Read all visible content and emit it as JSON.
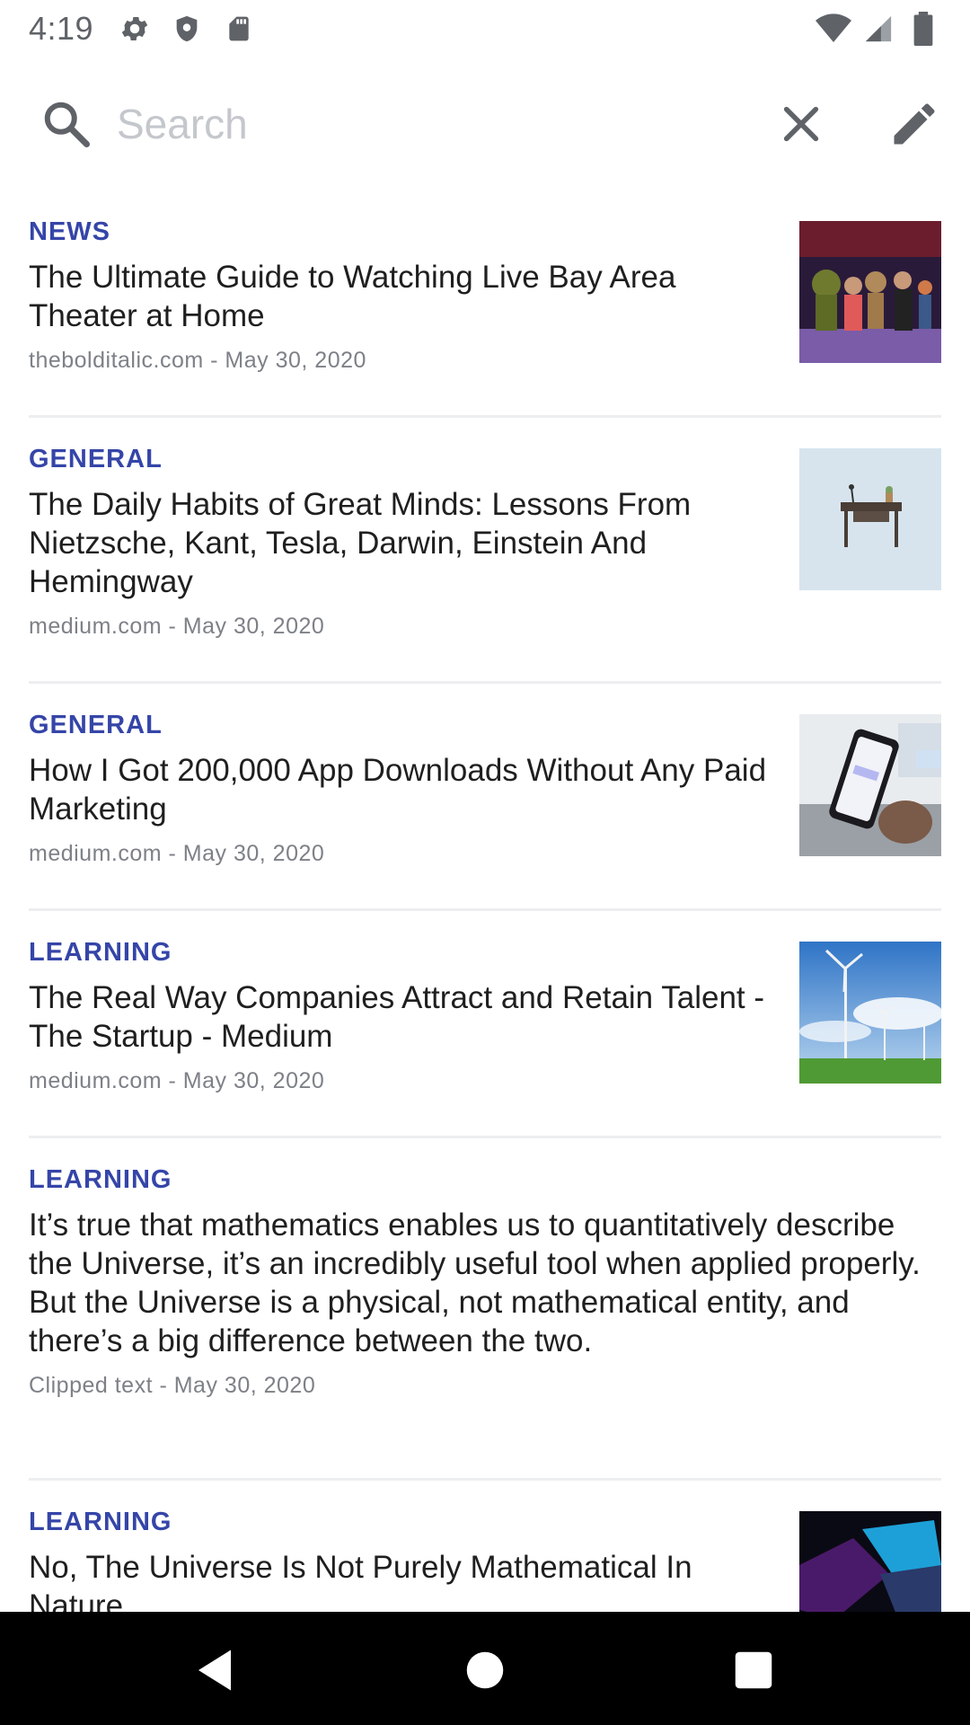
{
  "status": {
    "time": "4:19",
    "icons_left": [
      "gear-icon",
      "shield-icon",
      "sd-card-icon"
    ],
    "icons_right": [
      "wifi-icon",
      "signal-icon",
      "battery-icon"
    ]
  },
  "search": {
    "placeholder": "Search",
    "value": ""
  },
  "articles": [
    {
      "category": "NEWS",
      "title": "The Ultimate Guide to Watching Live Bay Area Theater at Home",
      "meta": "thebolditalic.com - May 30, 2020",
      "thumb": "theater-stage-image"
    },
    {
      "category": "GENERAL",
      "title": "The Daily Habits of Great Minds: Lessons From Nietzsche, Kant, Tesla, Darwin, Einstein And Hemingway",
      "meta": "medium.com - May 30, 2020",
      "thumb": "desk-illustration-image"
    },
    {
      "category": "GENERAL",
      "title": "How I Got 200,000 App Downloads Without Any Paid Marketing",
      "meta": "medium.com - May 30, 2020",
      "thumb": "phone-in-hand-image"
    },
    {
      "category": "LEARNING",
      "title": "The Real Way Companies Attract and Retain Talent - The Startup - Medium",
      "meta": "medium.com - May 30, 2020",
      "thumb": "wind-turbines-image"
    },
    {
      "category": "LEARNING",
      "title": "It’s true that mathematics enables us to quantitatively describe the Universe, it’s an incredibly useful tool when applied properly. But the Universe is a physical, not mathematical entity, and there’s a big difference between the two.",
      "meta": "Clipped text - May 30, 2020",
      "thumb": ""
    },
    {
      "category": "LEARNING",
      "title": "No, The Universe Is Not Purely Mathematical In Nature",
      "meta": "",
      "thumb": "abstract-3d-image"
    }
  ],
  "navbar": {
    "buttons": [
      "back-icon",
      "home-icon",
      "recents-icon"
    ]
  }
}
